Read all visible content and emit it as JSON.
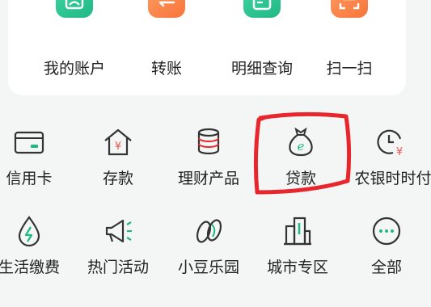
{
  "top_actions": [
    {
      "label": "我的账户",
      "icon": "account-icon"
    },
    {
      "label": "转账",
      "icon": "transfer-icon"
    },
    {
      "label": "明细查询",
      "icon": "statement-icon"
    },
    {
      "label": "扫一扫",
      "icon": "scan-icon"
    }
  ],
  "services_row1": [
    {
      "label": "信用卡",
      "icon": "credit-card-icon"
    },
    {
      "label": "存款",
      "icon": "deposit-house-icon"
    },
    {
      "label": "理财产品",
      "icon": "coin-stack-icon"
    },
    {
      "label": "贷款",
      "icon": "money-bag-icon"
    },
    {
      "label": "农银时时付",
      "icon": "clock-yuan-icon"
    }
  ],
  "services_row2": [
    {
      "label": "生活缴费",
      "icon": "water-drop-icon"
    },
    {
      "label": "热门活动",
      "icon": "megaphone-icon"
    },
    {
      "label": "小豆乐园",
      "icon": "beans-icon"
    },
    {
      "label": "城市专区",
      "icon": "building-icon"
    },
    {
      "label": "全部",
      "icon": "more-dots-icon"
    }
  ],
  "colors": {
    "accent_green": "#1fb885",
    "accent_orange": "#f7743a",
    "annotation_red": "#e8262b"
  }
}
